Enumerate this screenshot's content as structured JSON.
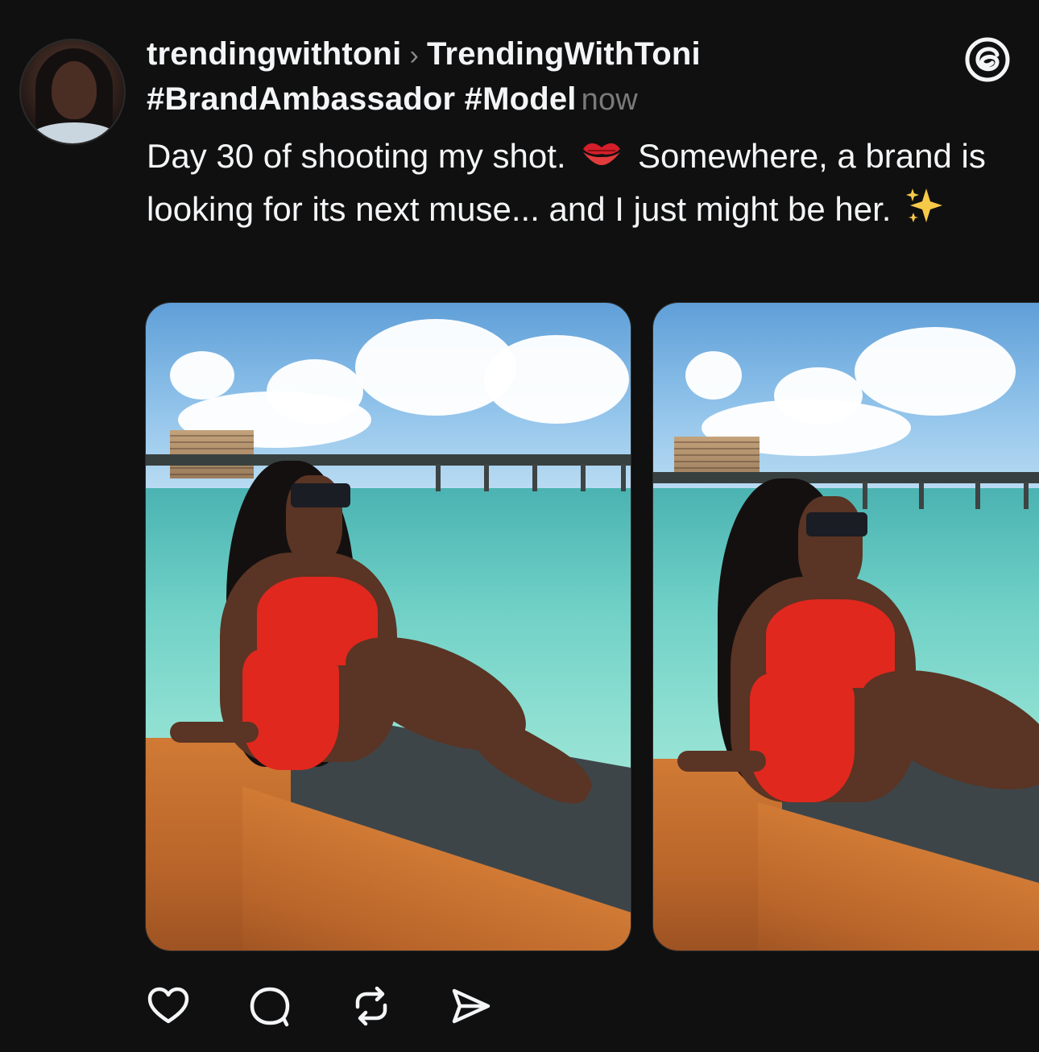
{
  "post": {
    "username": "trendingwithtoni",
    "community": "TrendingWithToni",
    "tags": "#BrandAmbassador #Model",
    "timestamp": "now",
    "caption": {
      "part1": "Day 30 of shooting my shot.",
      "part2": "Somewhere, a brand is looking for its next muse... and I just might be her."
    }
  },
  "icons": {
    "separator": "chevron-right-icon",
    "logo": "threads-logo-icon",
    "emoji1": "kiss-mark-emoji",
    "emoji2": "sparkles-emoji"
  },
  "actions": [
    "like-icon",
    "comment-icon",
    "repost-icon",
    "share-icon"
  ]
}
